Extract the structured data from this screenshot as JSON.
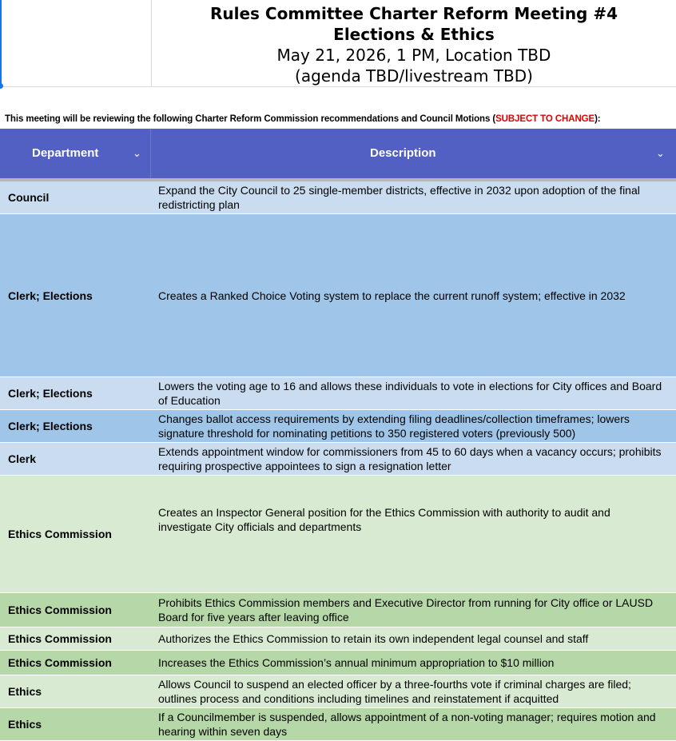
{
  "header": {
    "line1": "Rules Committee Charter Reform Meeting #4",
    "line2": "Elections & Ethics",
    "line3": "May 21, 2026, 1 PM, Location TBD",
    "line4": "(agenda TBD/livestream TBD)"
  },
  "note": {
    "prefix": "This meeting will be reviewing the following Charter Reform Commission recommendations and Council Motions (",
    "highlight": "SUBJECT TO CHANGE",
    "suffix": "):"
  },
  "table": {
    "columns": [
      "Department",
      "Description"
    ],
    "rows": [
      {
        "dept": "Council",
        "desc": "Expand the City Council to 25 single-member districts, effective in 2032 upon adoption of the final redistricting plan"
      },
      {
        "dept": "Clerk; Elections",
        "desc": "Creates a Ranked Choice Voting system to replace the current runoff system; effective in 2032"
      },
      {
        "dept": "Clerk; Elections",
        "desc": "Lowers the voting age to 16 and allows these individuals to vote in elections for City offices and Board of Education"
      },
      {
        "dept": "Clerk; Elections",
        "desc": "Changes ballot access requirements by extending filing deadlines/collection timeframes; lowers signature threshold for nominating petitions to 350 registered voters (previously 500)"
      },
      {
        "dept": "Clerk",
        "desc": "Extends appointment window for commissioners from 45 to 60 days when a vacancy occurs; prohibits requiring prospective appointees to sign a resignation letter"
      },
      {
        "dept": "Ethics Commission",
        "desc": "Creates an Inspector General position for the Ethics Commission with authority to audit and investigate City officials and departments"
      },
      {
        "dept": "Ethics Commission",
        "desc": "Prohibits Ethics Commission members and Executive Director from running for City office or LAUSD Board for five years after leaving office"
      },
      {
        "dept": "Ethics Commission",
        "desc": "Authorizes the Ethics Commission to retain its own independent legal counsel and staff"
      },
      {
        "dept": "Ethics Commission",
        "desc": "Increases the Ethics Commission’s annual minimum appropriation to $10 million"
      },
      {
        "dept": "Ethics",
        "desc": "Allows Council to suspend an elected officer by a three-fourths vote if criminal charges are filed; outlines process and conditions including timelines and reinstatement if acquitted"
      },
      {
        "dept": "Ethics",
        "desc": "If a Councilmember is suspended, allows appointment of a non-voting manager; requires motion and hearing within seven days"
      }
    ]
  },
  "colors": {
    "header_bg": "#5260c4",
    "blue_light": "#c9dcf0",
    "blue_dark": "#9fc5e8",
    "green_light": "#d9ead3",
    "green_dark": "#b6d7a8",
    "warning": "#e00000"
  }
}
